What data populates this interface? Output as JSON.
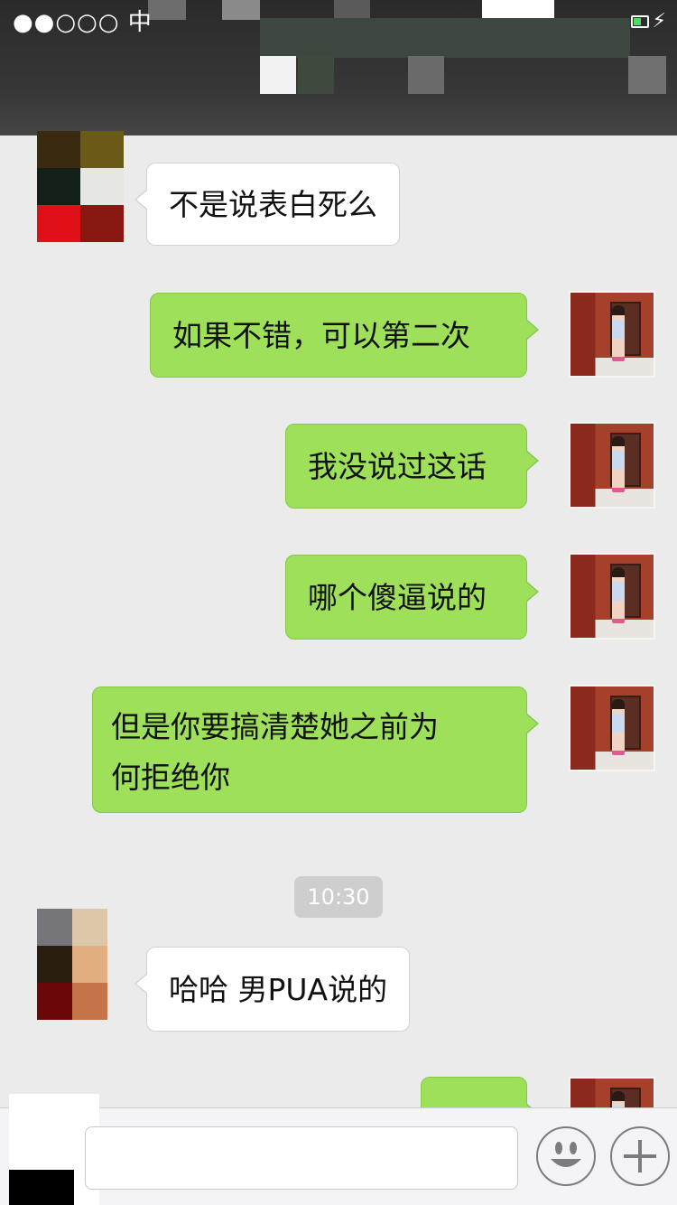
{
  "status_bar": {
    "signal": "●●○○○",
    "carrier": "中",
    "battery": "⚡"
  },
  "messages": [
    {
      "side": "left",
      "text": "不是说表白死么"
    },
    {
      "side": "right",
      "text": "如果不错，可以第二次"
    },
    {
      "side": "right",
      "text": "我没说过这话"
    },
    {
      "side": "right",
      "text": "哪个傻逼说的"
    },
    {
      "side": "right",
      "line1": "但是你要搞清楚她之前为",
      "line2": "何拒绝你"
    },
    {
      "side": "left",
      "text": "哈哈 男PUA说的"
    },
    {
      "side": "right",
      "text": ""
    }
  ],
  "timestamp": "10:30",
  "input_bar": {
    "placeholder": "",
    "emoji_icon": "smiley-face",
    "more_icon": "plus"
  },
  "colors": {
    "background": "#ebebeb",
    "my_bubble": "#9ee05a",
    "their_bubble": "#ffffff",
    "timestamp_pill": "#cecece"
  }
}
